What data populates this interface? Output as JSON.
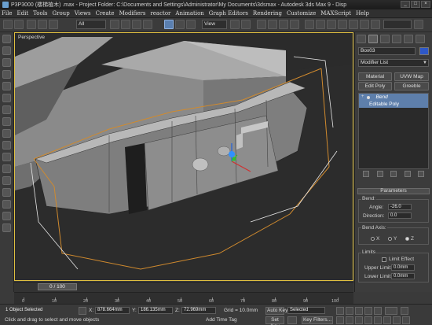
{
  "window": {
    "title": "P3P3000 (楼梯植木) .max  - Project Folder: C:\\Documents and Settings\\Administrator\\My Documents\\3dsmax  - Autodesk 3ds Max 9  - Disp",
    "controls": [
      "_",
      "□",
      "×"
    ]
  },
  "menu": [
    "File",
    "Edit",
    "Tools",
    "Group",
    "Views",
    "Create",
    "Modifiers",
    "reactor",
    "Animation",
    "Graph Editors",
    "Rendering",
    "Customize",
    "MAXScript",
    "Help"
  ],
  "toolbar": {
    "selection_filter": "All",
    "reference_coord": "View"
  },
  "viewport": {
    "label": "Perspective"
  },
  "command_panel": {
    "object_name": "Box03",
    "object_color": "#2e58c8",
    "modifier_list": "Modifier List",
    "buttons": [
      "Material",
      "UVW Map",
      "Edit Poly",
      "Greeble"
    ],
    "stack": [
      {
        "label": "Bend",
        "selected": true,
        "expand": "+"
      },
      {
        "label": "Editable Poly",
        "selected": true
      }
    ],
    "parameters": {
      "rollout_title": "Parameters",
      "bend_label": "Bend:",
      "angle_label": "Angle:",
      "angle_value": "-26.0",
      "direction_label": "Direction:",
      "direction_value": "0.0",
      "bend_axis_label": "Bend Axis:",
      "axes": [
        "X",
        "Y",
        "Z"
      ],
      "selected_axis": "Z",
      "limits_label": "Limits",
      "limit_effect_label": "Limit Effect",
      "upper_limit_label": "Upper Limit:",
      "upper_limit_value": "0.0mm",
      "lower_limit_label": "Lower Limit:",
      "lower_limit_value": "0.0mm"
    }
  },
  "timeline": {
    "slider_text": "0 / 100",
    "ticks": [
      "0",
      "10",
      "20",
      "30",
      "40",
      "50",
      "60",
      "70",
      "80",
      "90",
      "100"
    ]
  },
  "status": {
    "selection": "1 Object Selected",
    "prompt": "Click and drag to select and move objects",
    "x_label": "X:",
    "x_value": "878.664mm",
    "y_label": "Y:",
    "y_value": "186.135mm",
    "z_label": "Z:",
    "z_value": "72.969mm",
    "grid": "Grid = 10.0mm",
    "add_time_tag": "Add Time Tag",
    "auto_key": "Auto Key",
    "set_key": "Set Key",
    "selected_dropdown": "Selected",
    "key_filters": "Key Filters..."
  }
}
